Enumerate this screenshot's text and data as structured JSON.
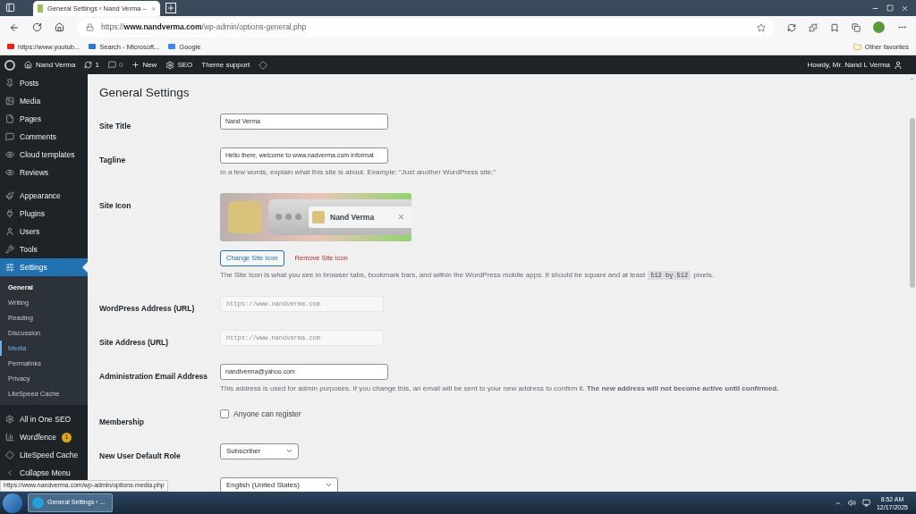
{
  "browser": {
    "tab_title": "General Settings ‹ Nand Verma –",
    "url_prefix": "https://",
    "url_host": "www.nandverma.com",
    "url_path": "/wp-admin/options-general.php",
    "bookmarks": [
      "https://www.youtub...",
      "Search - Microsoft...",
      "Google"
    ],
    "other_favorites": "Other favorites"
  },
  "admin_bar": {
    "site_name": "Nand Verma",
    "updates": "1",
    "comments": "0",
    "new": "New",
    "seo": "SEO",
    "theme_support": "Theme support",
    "howdy": "Howdy, Mr. Nand L Verma"
  },
  "sidebar": {
    "groups": [
      [
        {
          "label": "Posts",
          "selected": false
        },
        {
          "label": "Media",
          "selected": false
        },
        {
          "label": "Pages",
          "selected": false
        },
        {
          "label": "Comments",
          "selected": false
        },
        {
          "label": "Cloud templates",
          "selected": false
        },
        {
          "label": "Reviews",
          "selected": false
        }
      ],
      [
        {
          "label": "Appearance",
          "selected": false
        },
        {
          "label": "Plugins",
          "selected": false
        },
        {
          "label": "Users",
          "selected": false
        },
        {
          "label": "Tools",
          "selected": false
        },
        {
          "label": "Settings",
          "selected": true,
          "children": [
            {
              "label": "General",
              "selected": true,
              "hovered": false
            },
            {
              "label": "Writing",
              "selected": false,
              "hovered": false
            },
            {
              "label": "Reading",
              "selected": false,
              "hovered": false
            },
            {
              "label": "Discussion",
              "selected": false,
              "hovered": false
            },
            {
              "label": "Media",
              "selected": false,
              "hovered": true
            },
            {
              "label": "Permalinks",
              "selected": false,
              "hovered": false
            },
            {
              "label": "Privacy",
              "selected": false,
              "hovered": false
            },
            {
              "label": "LiteSpeed Cache",
              "selected": false,
              "hovered": false
            }
          ]
        }
      ],
      [
        {
          "label": "All in One SEO",
          "selected": false
        },
        {
          "label": "Wordfence",
          "selected": false,
          "badge": "1"
        },
        {
          "label": "LiteSpeed Cache",
          "selected": false
        },
        {
          "label": "Collapse Menu",
          "selected": false
        }
      ]
    ]
  },
  "page": {
    "title": "General Settings",
    "rows": [
      {
        "kind": "text",
        "label": "Site Title",
        "value": "Nand Verma"
      },
      {
        "kind": "text",
        "label": "Tagline",
        "value": "Hello there, welcome to www.nadverma.com Informat",
        "description": "In a few words, explain what this site is about. Example: “Just another WordPress site.”"
      },
      {
        "kind": "icon",
        "label": "Site Icon",
        "preview_title": "Nand Verma",
        "change_button": "Change Site Icon",
        "remove_link": "Remove Site Icon",
        "description": "The Site Icon is what you see in browser tabs, bookmark bars, and within the WordPress mobile apps. It should be square and at least",
        "size": "512 by 512",
        "description_end": "pixels."
      },
      {
        "kind": "readonly",
        "label": "WordPress Address (URL)",
        "value": "https://www.nandverma.com"
      },
      {
        "kind": "readonly",
        "label": "Site Address (URL)",
        "value": "https://www.nandverma.com"
      },
      {
        "kind": "text",
        "label": "Administration Email Address",
        "value": "nandlverma@yahoo.com",
        "description": "This address is used for admin purposes. If you change this, an email will be sent to your new address to confirm it. **The new address will not become active until confirmed.**"
      },
      {
        "kind": "checkbox",
        "label": "Membership",
        "option": "Anyone can register",
        "checked": false
      },
      {
        "kind": "select",
        "label": "New User Default Role",
        "value": "Subscriber"
      },
      {
        "kind": "select",
        "value": "English (United States)"
      }
    ]
  },
  "status_url": "https://www.nandverma.com/wp-admin/options-media.php",
  "taskbar": {
    "task": "General Settings ‹ ...",
    "time": "8:52 AM",
    "date": "12/17/2025"
  }
}
